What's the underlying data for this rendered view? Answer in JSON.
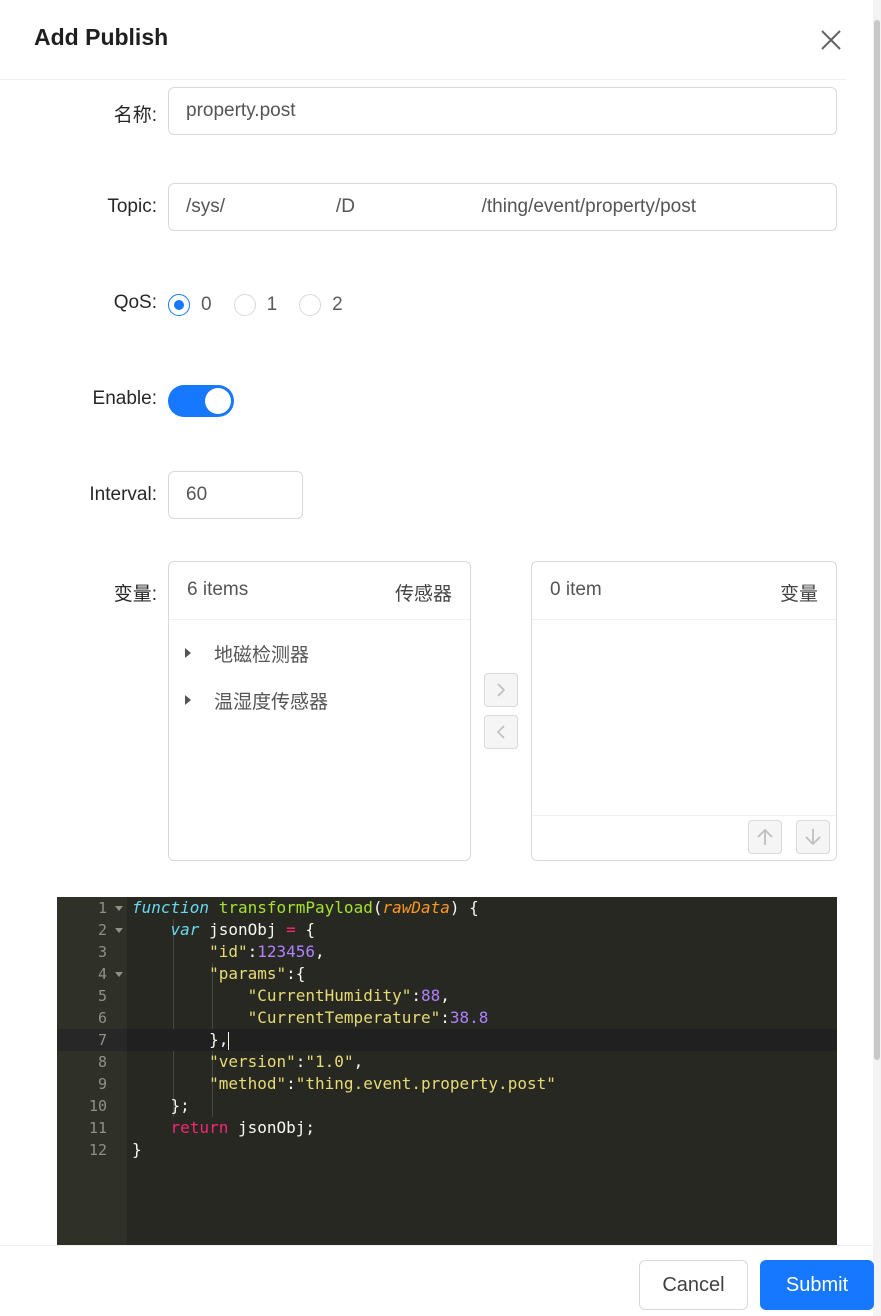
{
  "modal": {
    "title": "Add Publish"
  },
  "form": {
    "name": {
      "label": "名称",
      "value": "property.post"
    },
    "topic": {
      "label": "Topic",
      "value": "/sys/                     /D                        /thing/event/property/post"
    },
    "qos": {
      "label": "QoS",
      "options": [
        "0",
        "1",
        "2"
      ],
      "selected": "0"
    },
    "enable": {
      "label": "Enable",
      "checked": true
    },
    "interval": {
      "label": "Interval",
      "value": "60"
    },
    "variables": {
      "label": "变量",
      "source": {
        "count": "6 items",
        "title": "传感器",
        "items": [
          "地磁检测器",
          "温湿度传感器"
        ]
      },
      "target": {
        "count": "0 item",
        "title": "变量"
      }
    }
  },
  "editor": {
    "lines": [
      "function transformPayload(rawData) {",
      "    var jsonObj = {",
      "        \"id\":123456,",
      "        \"params\":{",
      "            \"CurrentHumidity\":88,",
      "            \"CurrentTemperature\":38.8",
      "        },",
      "        \"version\":\"1.0\",",
      "        \"method\":\"thing.event.property.post\"",
      "    };",
      "    return jsonObj;",
      "}"
    ],
    "line_numbers": [
      "1",
      "2",
      "3",
      "4",
      "5",
      "6",
      "7",
      "8",
      "9",
      "10",
      "11",
      "12"
    ],
    "active_line": 7
  },
  "footer": {
    "cancel_label": "Cancel",
    "submit_label": "Submit"
  },
  "colors": {
    "primary": "#1677ff",
    "editor_bg": "#272822"
  },
  "icons": [
    "close-icon",
    "caret-right-icon",
    "chevron-right-icon",
    "chevron-left-icon",
    "arrow-up-icon",
    "arrow-down-icon",
    "fold-icon"
  ]
}
